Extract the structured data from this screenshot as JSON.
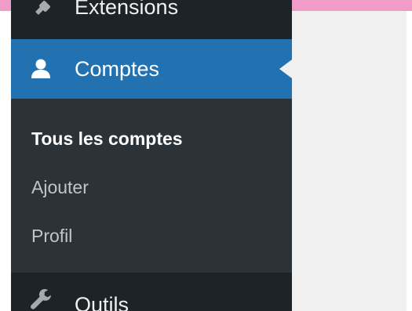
{
  "sidebar": {
    "items": [
      {
        "label": "Extensions",
        "icon": "plug-icon"
      },
      {
        "label": "Comptes",
        "icon": "user-icon",
        "active": true
      },
      {
        "label": "Outils",
        "icon": "wrench-icon"
      }
    ],
    "submenu": [
      {
        "label": "Tous les comptes",
        "current": true
      },
      {
        "label": "Ajouter"
      },
      {
        "label": "Profil"
      }
    ]
  },
  "colors": {
    "sidebar_bg": "#1d2327",
    "submenu_bg": "#2c3338",
    "active_bg": "#2271b1",
    "content_bg": "#f0f0f1",
    "top_band": "#f19cc8"
  }
}
